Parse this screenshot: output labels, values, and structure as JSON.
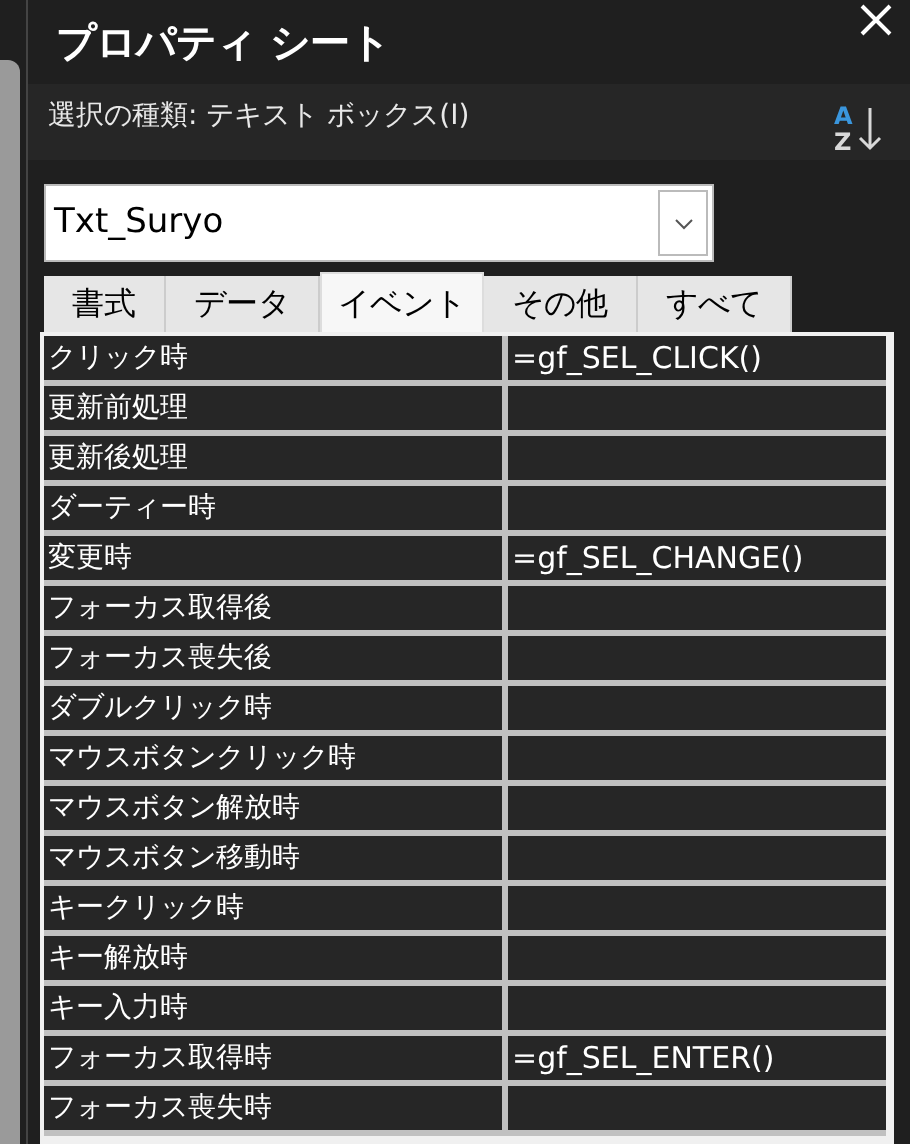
{
  "window": {
    "title": "プロパティ シート"
  },
  "selection_type": "選択の種類: テキスト ボックス(I)",
  "sort_button": {
    "letters": [
      "A",
      "Z"
    ]
  },
  "object_combo": {
    "value": "Txt_Suryo"
  },
  "tabs": [
    {
      "label": "書式",
      "selected": false
    },
    {
      "label": "データ",
      "selected": false
    },
    {
      "label": "イベント",
      "selected": true
    },
    {
      "label": "その他",
      "selected": false
    },
    {
      "label": "すべて",
      "selected": false
    }
  ],
  "properties": [
    {
      "name": "クリック時",
      "value": "=gf_SEL_CLICK()"
    },
    {
      "name": "更新前処理"
    },
    {
      "name": "更新後処理"
    },
    {
      "name": "ダーティー時"
    },
    {
      "name": "変更時",
      "value": "=gf_SEL_CHANGE()"
    },
    {
      "name": "フォーカス取得後"
    },
    {
      "name": "フォーカス喪失後"
    },
    {
      "name": "ダブルクリック時"
    },
    {
      "name": "マウスボタンクリック時"
    },
    {
      "name": "マウスボタン解放時"
    },
    {
      "name": "マウスボタン移動時"
    },
    {
      "name": "キークリック時"
    },
    {
      "name": "キー解放時"
    },
    {
      "name": "キー入力時"
    },
    {
      "name": "フォーカス取得時",
      "value": "=gf_SEL_ENTER()"
    },
    {
      "name": "フォーカス喪失時"
    }
  ]
}
